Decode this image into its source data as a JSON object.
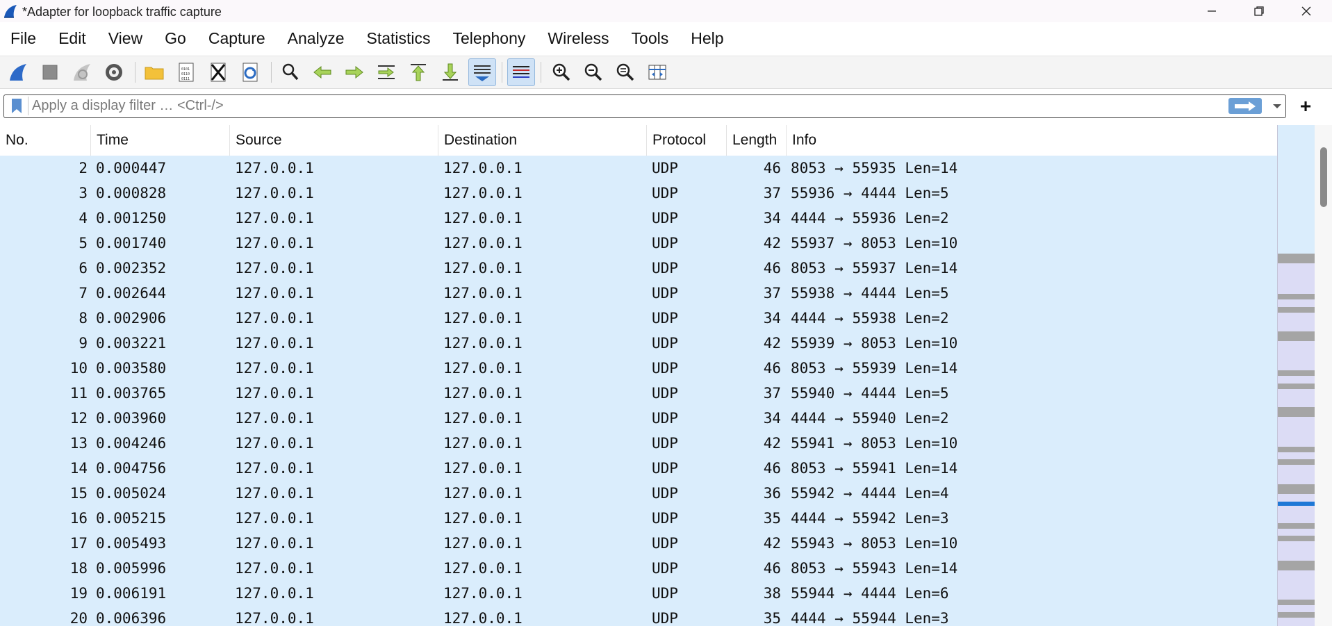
{
  "window": {
    "title": "*Adapter for loopback traffic capture",
    "controls": [
      "minimize-icon",
      "maximize-icon",
      "close-icon"
    ]
  },
  "menu": [
    "File",
    "Edit",
    "View",
    "Go",
    "Capture",
    "Analyze",
    "Statistics",
    "Telephony",
    "Wireless",
    "Tools",
    "Help"
  ],
  "toolbar": {
    "icons": [
      "start-capture-icon",
      "stop-capture-icon",
      "restart-capture-icon",
      "capture-options-icon",
      "open-file-icon",
      "save-file-icon",
      "close-file-icon",
      "reload-file-icon",
      "find-packet-icon",
      "go-back-icon",
      "go-forward-icon",
      "go-to-packet-icon",
      "first-packet-icon",
      "last-packet-icon",
      "autoscroll-icon",
      "colorize-icon",
      "zoom-in-icon",
      "zoom-out-icon",
      "normal-size-icon",
      "resize-columns-icon"
    ],
    "active": [
      "autoscroll-icon",
      "colorize-icon"
    ]
  },
  "filter": {
    "placeholder": "Apply a display filter … <Ctrl-/>",
    "value": "",
    "plus_label": "+"
  },
  "packet_list": {
    "columns": [
      "No.",
      "Time",
      "Source",
      "Destination",
      "Protocol",
      "Length",
      "Info"
    ],
    "rows": [
      {
        "no": "2",
        "time": "0.000447",
        "source": "127.0.0.1",
        "destination": "127.0.0.1",
        "protocol": "UDP",
        "length": "46",
        "info": "8053 → 55935 Len=14"
      },
      {
        "no": "3",
        "time": "0.000828",
        "source": "127.0.0.1",
        "destination": "127.0.0.1",
        "protocol": "UDP",
        "length": "37",
        "info": "55936 → 4444 Len=5"
      },
      {
        "no": "4",
        "time": "0.001250",
        "source": "127.0.0.1",
        "destination": "127.0.0.1",
        "protocol": "UDP",
        "length": "34",
        "info": "4444 → 55936 Len=2"
      },
      {
        "no": "5",
        "time": "0.001740",
        "source": "127.0.0.1",
        "destination": "127.0.0.1",
        "protocol": "UDP",
        "length": "42",
        "info": "55937 → 8053 Len=10"
      },
      {
        "no": "6",
        "time": "0.002352",
        "source": "127.0.0.1",
        "destination": "127.0.0.1",
        "protocol": "UDP",
        "length": "46",
        "info": "8053 → 55937 Len=14"
      },
      {
        "no": "7",
        "time": "0.002644",
        "source": "127.0.0.1",
        "destination": "127.0.0.1",
        "protocol": "UDP",
        "length": "37",
        "info": "55938 → 4444 Len=5"
      },
      {
        "no": "8",
        "time": "0.002906",
        "source": "127.0.0.1",
        "destination": "127.0.0.1",
        "protocol": "UDP",
        "length": "34",
        "info": "4444 → 55938 Len=2"
      },
      {
        "no": "9",
        "time": "0.003221",
        "source": "127.0.0.1",
        "destination": "127.0.0.1",
        "protocol": "UDP",
        "length": "42",
        "info": "55939 → 8053 Len=10"
      },
      {
        "no": "10",
        "time": "0.003580",
        "source": "127.0.0.1",
        "destination": "127.0.0.1",
        "protocol": "UDP",
        "length": "46",
        "info": "8053 → 55939 Len=14"
      },
      {
        "no": "11",
        "time": "0.003765",
        "source": "127.0.0.1",
        "destination": "127.0.0.1",
        "protocol": "UDP",
        "length": "37",
        "info": "55940 → 4444 Len=5"
      },
      {
        "no": "12",
        "time": "0.003960",
        "source": "127.0.0.1",
        "destination": "127.0.0.1",
        "protocol": "UDP",
        "length": "34",
        "info": "4444 → 55940 Len=2"
      },
      {
        "no": "13",
        "time": "0.004246",
        "source": "127.0.0.1",
        "destination": "127.0.0.1",
        "protocol": "UDP",
        "length": "42",
        "info": "55941 → 8053 Len=10"
      },
      {
        "no": "14",
        "time": "0.004756",
        "source": "127.0.0.1",
        "destination": "127.0.0.1",
        "protocol": "UDP",
        "length": "46",
        "info": "8053 → 55941 Len=14"
      },
      {
        "no": "15",
        "time": "0.005024",
        "source": "127.0.0.1",
        "destination": "127.0.0.1",
        "protocol": "UDP",
        "length": "36",
        "info": "55942 → 4444 Len=4"
      },
      {
        "no": "16",
        "time": "0.005215",
        "source": "127.0.0.1",
        "destination": "127.0.0.1",
        "protocol": "UDP",
        "length": "35",
        "info": "4444 → 55942 Len=3"
      },
      {
        "no": "17",
        "time": "0.005493",
        "source": "127.0.0.1",
        "destination": "127.0.0.1",
        "protocol": "UDP",
        "length": "42",
        "info": "55943 → 8053 Len=10"
      },
      {
        "no": "18",
        "time": "0.005996",
        "source": "127.0.0.1",
        "destination": "127.0.0.1",
        "protocol": "UDP",
        "length": "46",
        "info": "8053 → 55943 Len=14"
      },
      {
        "no": "19",
        "time": "0.006191",
        "source": "127.0.0.1",
        "destination": "127.0.0.1",
        "protocol": "UDP",
        "length": "38",
        "info": "55944 → 4444 Len=6"
      },
      {
        "no": "20",
        "time": "0.006396",
        "source": "127.0.0.1",
        "destination": "127.0.0.1",
        "protocol": "UDP",
        "length": "35",
        "info": "4444 → 55944 Len=3"
      }
    ]
  },
  "colors": {
    "row_background": "#daedfc",
    "minimap_background": "#dcdcf5",
    "minimap_selection": "#1e78d6",
    "apply_button": "#6b9fd6"
  }
}
